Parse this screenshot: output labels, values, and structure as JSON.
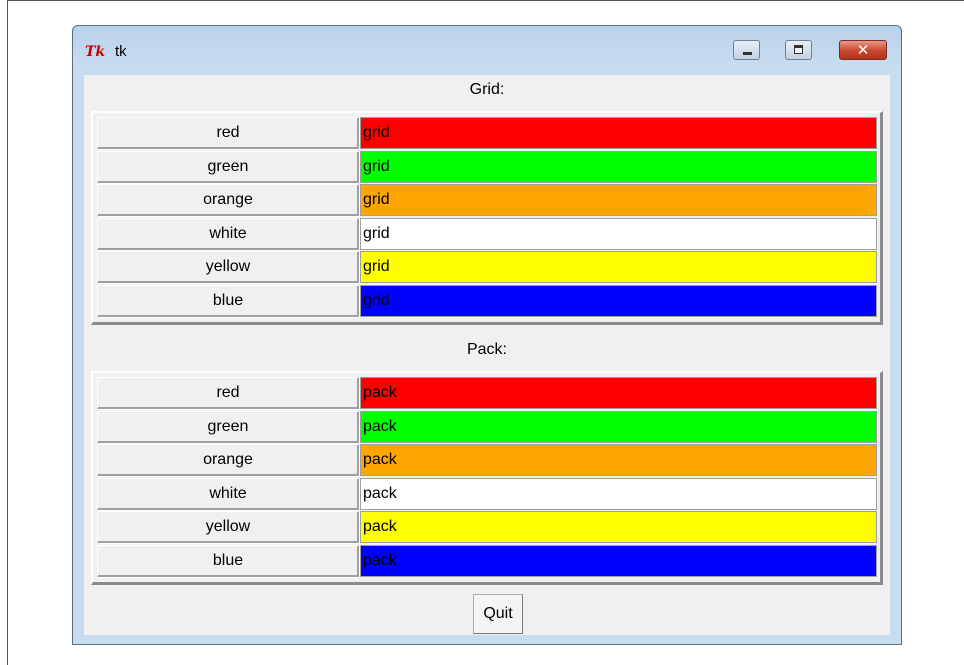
{
  "window": {
    "logo_text": "Tk",
    "title": "tk",
    "controls": {
      "minimize": "minimize",
      "maximize": "maximize",
      "close_glyph": "✕"
    }
  },
  "grid_section": {
    "label": "Grid:",
    "rows": [
      {
        "name": "red",
        "cell_text": "grid",
        "color": "#ff0000"
      },
      {
        "name": "green",
        "cell_text": "grid",
        "color": "#00ff00"
      },
      {
        "name": "orange",
        "cell_text": "grid",
        "color": "#ffa500"
      },
      {
        "name": "white",
        "cell_text": "grid",
        "color": "#ffffff"
      },
      {
        "name": "yellow",
        "cell_text": "grid",
        "color": "#ffff00"
      },
      {
        "name": "blue",
        "cell_text": "grid",
        "color": "#0000ff"
      }
    ]
  },
  "pack_section": {
    "label": "Pack:",
    "rows": [
      {
        "name": "red",
        "cell_text": "pack",
        "color": "#ff0000"
      },
      {
        "name": "green",
        "cell_text": "pack",
        "color": "#00ff00"
      },
      {
        "name": "orange",
        "cell_text": "pack",
        "color": "#ffa500"
      },
      {
        "name": "white",
        "cell_text": "pack",
        "color": "#ffffff"
      },
      {
        "name": "yellow",
        "cell_text": "pack",
        "color": "#ffff00"
      },
      {
        "name": "blue",
        "cell_text": "pack",
        "color": "#0000ff"
      }
    ]
  },
  "quit_button": {
    "label": "Quit"
  }
}
